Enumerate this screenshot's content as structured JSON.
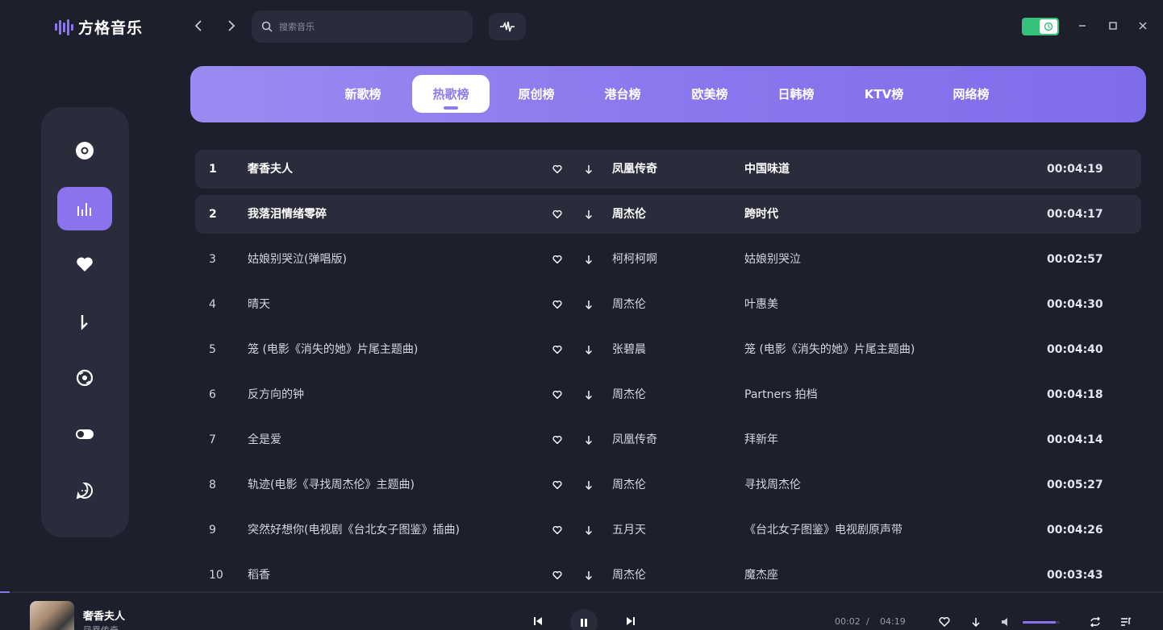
{
  "app": {
    "title": "方格音乐"
  },
  "search": {
    "placeholder": "搜索音乐"
  },
  "tabs": [
    {
      "label": "新歌榜",
      "active": false
    },
    {
      "label": "热歌榜",
      "active": true
    },
    {
      "label": "原创榜",
      "active": false
    },
    {
      "label": "港台榜",
      "active": false
    },
    {
      "label": "欧美榜",
      "active": false
    },
    {
      "label": "日韩榜",
      "active": false
    },
    {
      "label": "KTV榜",
      "active": false
    },
    {
      "label": "网络榜",
      "active": false
    }
  ],
  "sidebar": {
    "items": [
      {
        "icon": "disc-icon",
        "active": false
      },
      {
        "icon": "chart-bars-icon",
        "active": true
      },
      {
        "icon": "heart-icon",
        "active": false
      },
      {
        "icon": "download-icon",
        "active": false
      },
      {
        "icon": "cd-icon",
        "active": false
      },
      {
        "icon": "toggle-icon",
        "active": false
      },
      {
        "icon": "chat-icon",
        "active": false
      }
    ]
  },
  "songs": [
    {
      "index": "1",
      "title": "奢香夫人",
      "artist": "凤凰传奇",
      "album": "中国味道",
      "duration": "00:04:19",
      "highlight": true
    },
    {
      "index": "2",
      "title": "我落泪情绪零碎",
      "artist": "周杰伦",
      "album": "跨时代",
      "duration": "00:04:17",
      "highlight": true
    },
    {
      "index": "3",
      "title": "姑娘别哭泣(弹唱版)",
      "artist": "柯柯柯啊",
      "album": "姑娘别哭泣",
      "duration": "00:02:57",
      "highlight": false
    },
    {
      "index": "4",
      "title": "晴天",
      "artist": "周杰伦",
      "album": "叶惠美",
      "duration": "00:04:30",
      "highlight": false
    },
    {
      "index": "5",
      "title": "笼 (电影《消失的她》片尾主题曲)",
      "artist": "张碧晨",
      "album": "笼 (电影《消失的她》片尾主题曲)",
      "duration": "00:04:40",
      "highlight": false
    },
    {
      "index": "6",
      "title": "反方向的钟",
      "artist": "周杰伦",
      "album": "Partners 拍档",
      "duration": "00:04:18",
      "highlight": false
    },
    {
      "index": "7",
      "title": "全是爱",
      "artist": "凤凰传奇",
      "album": "拜新年",
      "duration": "00:04:14",
      "highlight": false
    },
    {
      "index": "8",
      "title": "轨迹(电影《寻找周杰伦》主题曲)",
      "artist": "周杰伦",
      "album": "寻找周杰伦",
      "duration": "00:05:27",
      "highlight": false
    },
    {
      "index": "9",
      "title": "突然好想你(电视剧《台北女子图鉴》插曲)",
      "artist": "五月天",
      "album": "《台北女子图鉴》电视剧原声带",
      "duration": "00:04:26",
      "highlight": false
    },
    {
      "index": "10",
      "title": "稻香",
      "artist": "周杰伦",
      "album": "魔杰座",
      "duration": "00:03:43",
      "highlight": false
    }
  ],
  "player": {
    "title": "奢香夫人",
    "artist": "凤凰传奇",
    "current_time": "00:02",
    "separator": "/",
    "total_time": "04:19",
    "progress": 0.008,
    "volume": 0.9
  },
  "colors": {
    "accent": "#8b72ee",
    "background": "#1e1f2c",
    "panel": "#2a2b3b",
    "toggle": "#35c27a"
  }
}
